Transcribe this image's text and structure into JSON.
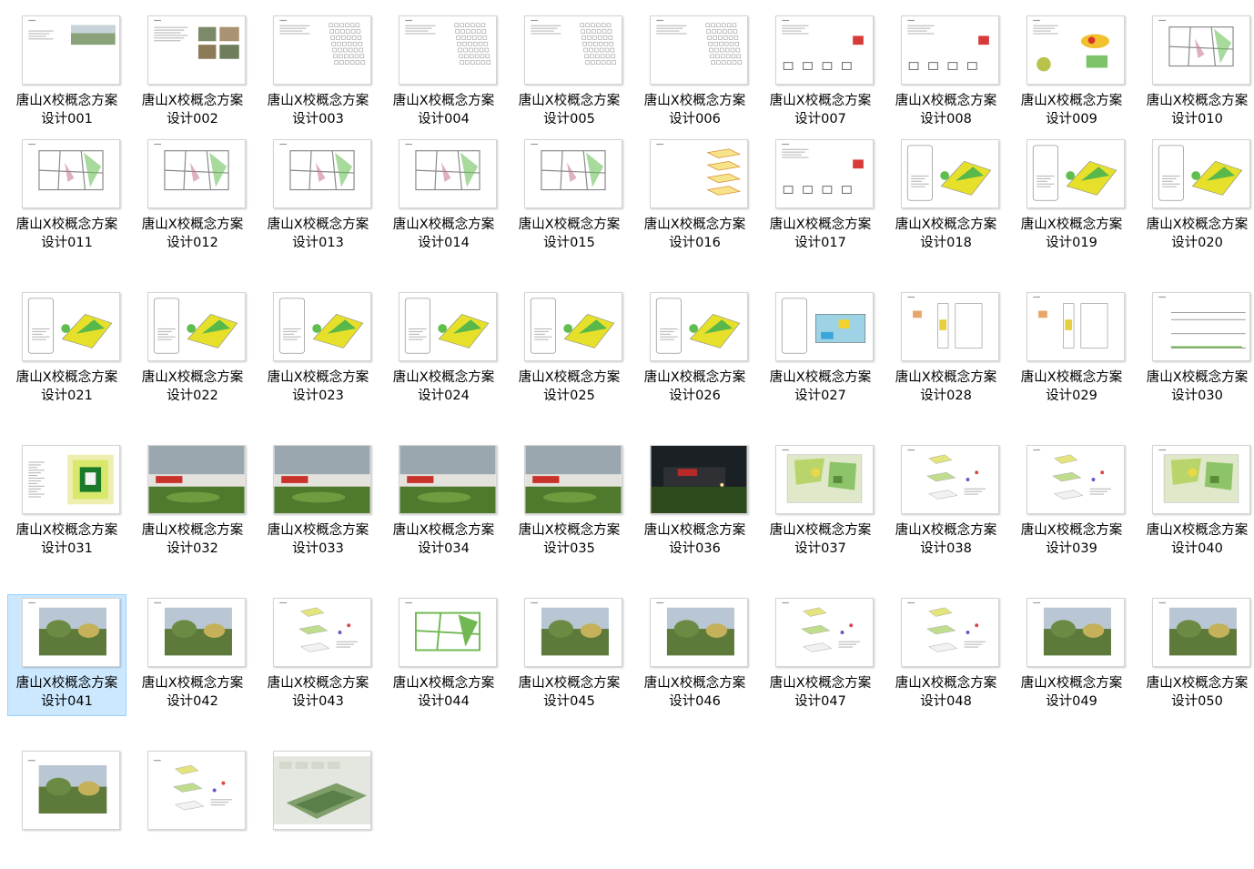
{
  "explorer": {
    "selected_file": "唐山X校概念方案设计041",
    "files": [
      {
        "line1": "唐山X校概念方案",
        "line2": "设计001",
        "preview": "cover"
      },
      {
        "line1": "唐山X校概念方案",
        "line2": "设计002",
        "preview": "text-photos"
      },
      {
        "line1": "唐山X校概念方案",
        "line2": "设计003",
        "preview": "grid-diagram"
      },
      {
        "line1": "唐山X校概念方案",
        "line2": "设计004",
        "preview": "grid-diagram"
      },
      {
        "line1": "唐山X校概念方案",
        "line2": "设计005",
        "preview": "grid-diagram"
      },
      {
        "line1": "唐山X校概念方案",
        "line2": "设计006",
        "preview": "grid-diagram"
      },
      {
        "line1": "唐山X校概念方案",
        "line2": "设计007",
        "preview": "icons"
      },
      {
        "line1": "唐山X校概念方案",
        "line2": "设计008",
        "preview": "icons"
      },
      {
        "line1": "唐山X校概念方案",
        "line2": "设计009",
        "preview": "colorful"
      },
      {
        "line1": "唐山X校概念方案",
        "line2": "设计010",
        "preview": "plan"
      },
      {
        "line1": "唐山X校概念方案",
        "line2": "设计011",
        "preview": "plan"
      },
      {
        "line1": "唐山X校概念方案",
        "line2": "设计012",
        "preview": "plan"
      },
      {
        "line1": "唐山X校概念方案",
        "line2": "设计013",
        "preview": "plan"
      },
      {
        "line1": "唐山X校概念方案",
        "line2": "设计014",
        "preview": "plan"
      },
      {
        "line1": "唐山X校概念方案",
        "line2": "设计015",
        "preview": "plan"
      },
      {
        "line1": "唐山X校概念方案",
        "line2": "设计016",
        "preview": "stack"
      },
      {
        "line1": "唐山X校概念方案",
        "line2": "设计017",
        "preview": "icons"
      },
      {
        "line1": "唐山X校概念方案",
        "line2": "设计018",
        "preview": "axon"
      },
      {
        "line1": "唐山X校概念方案",
        "line2": "设计019",
        "preview": "axon"
      },
      {
        "line1": "唐山X校概念方案",
        "line2": "设计020",
        "preview": "axon"
      },
      {
        "line1": "唐山X校概念方案",
        "line2": "设计021",
        "preview": "axon"
      },
      {
        "line1": "唐山X校概念方案",
        "line2": "设计022",
        "preview": "axon"
      },
      {
        "line1": "唐山X校概念方案",
        "line2": "设计023",
        "preview": "axon"
      },
      {
        "line1": "唐山X校概念方案",
        "line2": "设计024",
        "preview": "axon"
      },
      {
        "line1": "唐山X校概念方案",
        "line2": "设计025",
        "preview": "axon"
      },
      {
        "line1": "唐山X校概念方案",
        "line2": "设计026",
        "preview": "axon"
      },
      {
        "line1": "唐山X校概念方案",
        "line2": "设计027",
        "preview": "section"
      },
      {
        "line1": "唐山X校概念方案",
        "line2": "设计028",
        "preview": "elevation"
      },
      {
        "line1": "唐山X校概念方案",
        "line2": "设计029",
        "preview": "elevation"
      },
      {
        "line1": "唐山X校概念方案",
        "line2": "设计030",
        "preview": "lines"
      },
      {
        "line1": "唐山X校概念方案",
        "line2": "设计031",
        "preview": "site"
      },
      {
        "line1": "唐山X校概念方案",
        "line2": "设计032",
        "preview": "render-day"
      },
      {
        "line1": "唐山X校概念方案",
        "line2": "设计033",
        "preview": "render-day"
      },
      {
        "line1": "唐山X校概念方案",
        "line2": "设计034",
        "preview": "render-day"
      },
      {
        "line1": "唐山X校概念方案",
        "line2": "设计035",
        "preview": "render-day"
      },
      {
        "line1": "唐山X校概念方案",
        "line2": "设计036",
        "preview": "render-night"
      },
      {
        "line1": "唐山X校概念方案",
        "line2": "设计037",
        "preview": "colored-plan"
      },
      {
        "line1": "唐山X校概念方案",
        "line2": "设计038",
        "preview": "exploded"
      },
      {
        "line1": "唐山X校概念方案",
        "line2": "设计039",
        "preview": "exploded"
      },
      {
        "line1": "唐山X校概念方案",
        "line2": "设计040",
        "preview": "colored-plan"
      },
      {
        "line1": "唐山X校概念方案",
        "line2": "设计041",
        "preview": "photo"
      },
      {
        "line1": "唐山X校概念方案",
        "line2": "设计042",
        "preview": "photo"
      },
      {
        "line1": "唐山X校概念方案",
        "line2": "设计043",
        "preview": "exploded"
      },
      {
        "line1": "唐山X校概念方案",
        "line2": "设计044",
        "preview": "green-plan"
      },
      {
        "line1": "唐山X校概念方案",
        "line2": "设计045",
        "preview": "photo"
      },
      {
        "line1": "唐山X校概念方案",
        "line2": "设计046",
        "preview": "photo"
      },
      {
        "line1": "唐山X校概念方案",
        "line2": "设计047",
        "preview": "exploded"
      },
      {
        "line1": "唐山X校概念方案",
        "line2": "设计048",
        "preview": "exploded"
      },
      {
        "line1": "唐山X校概念方案",
        "line2": "设计049",
        "preview": "photo"
      },
      {
        "line1": "唐山X校概念方案",
        "line2": "设计050",
        "preview": "photo"
      },
      {
        "line1": "",
        "line2": "",
        "preview": "photo"
      },
      {
        "line1": "",
        "line2": "",
        "preview": "exploded"
      },
      {
        "line1": "",
        "line2": "",
        "preview": "aerial"
      }
    ]
  },
  "colors": {
    "selection_fill": "#cce8ff",
    "selection_border": "#99d1ff",
    "label_text": "#000000",
    "thumb_border": "#d4d4d4"
  }
}
